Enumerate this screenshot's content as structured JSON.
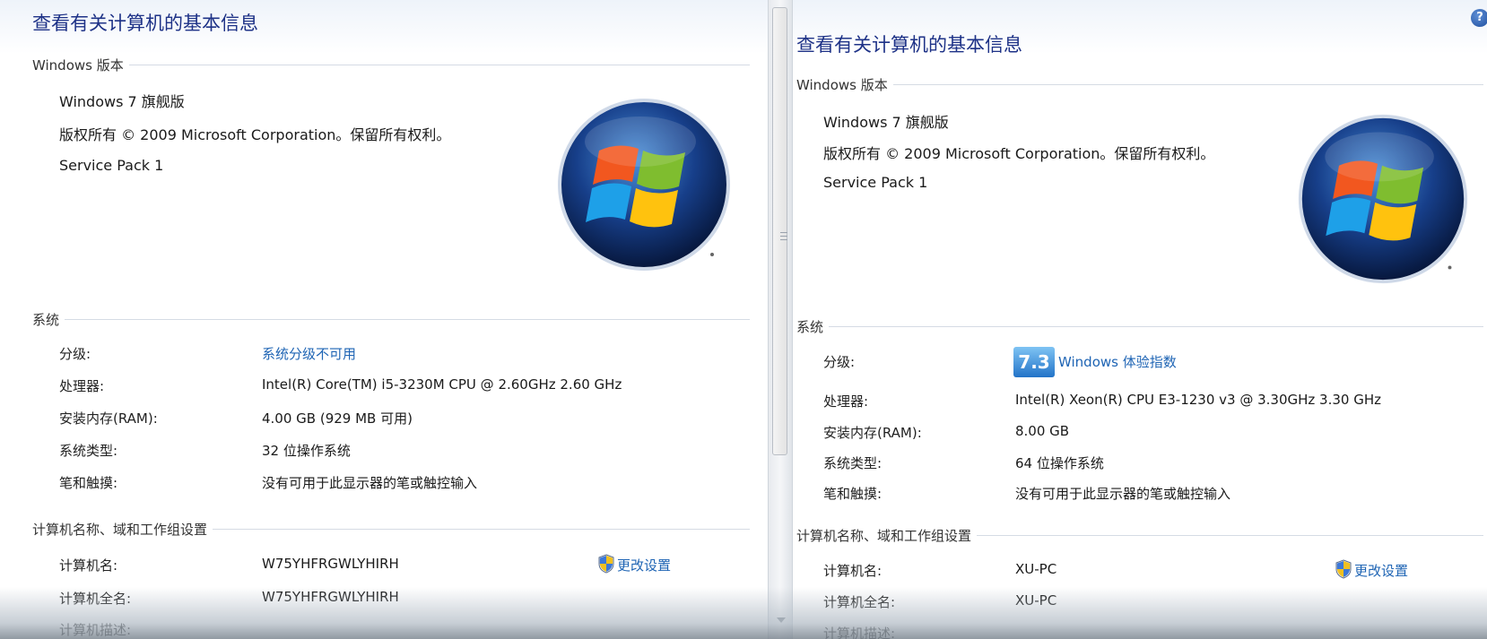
{
  "left": {
    "title": "查看有关计算机的基本信息",
    "edition_header": "Windows 版本",
    "edition": "Windows 7 旗舰版",
    "copyright": "版权所有 © 2009 Microsoft Corporation。保留所有权利。",
    "service_pack": "Service Pack 1",
    "system_header": "系统",
    "labels": {
      "rating": "分级:",
      "processor": "处理器:",
      "ram": "安装内存(RAM):",
      "system_type": "系统类型:",
      "pen_touch": "笔和触摸:"
    },
    "values": {
      "rating_link": "系统分级不可用",
      "processor": "Intel(R) Core(TM) i5-3230M CPU @ 2.60GHz   2.60 GHz",
      "ram": "4.00 GB (929 MB 可用)",
      "system_type": "32 位操作系统",
      "pen_touch": "没有可用于此显示器的笔或触控输入"
    },
    "computer_header": "计算机名称、域和工作组设置",
    "computer": {
      "name_label": "计算机名:",
      "name_value": "W75YHFRGWLYHIRH",
      "fullname_label": "计算机全名:",
      "fullname_value": "W75YHFRGWLYHIRH",
      "desc_label": "计算机描述:",
      "change_settings": "更改设置"
    }
  },
  "right": {
    "title": "查看有关计算机的基本信息",
    "edition_header": "Windows 版本",
    "edition": "Windows 7 旗舰版",
    "copyright": "版权所有 © 2009 Microsoft Corporation。保留所有权利。",
    "service_pack": "Service Pack 1",
    "system_header": "系统",
    "labels": {
      "rating": "分级:",
      "processor": "处理器:",
      "ram": "安装内存(RAM):",
      "system_type": "系统类型:",
      "pen_touch": "笔和触摸:"
    },
    "values": {
      "wei_score": "7.3",
      "wei_link": "Windows 体验指数",
      "processor": "Intel(R) Xeon(R) CPU E3-1230 v3 @ 3.30GHz   3.30 GHz",
      "ram": "8.00 GB",
      "system_type": "64 位操作系统",
      "pen_touch": "没有可用于此显示器的笔或触控输入"
    },
    "computer_header": "计算机名称、域和工作组设置",
    "computer": {
      "name_label": "计算机名:",
      "name_value": "XU-PC",
      "fullname_label": "计算机全名:",
      "fullname_value": "XU-PC",
      "desc_label": "计算机描述:",
      "change_settings": "更改设置"
    }
  },
  "help_glyph": "?",
  "icons": {
    "logo": "windows-logo-icon",
    "shield": "uac-shield-icon",
    "help": "help-icon"
  },
  "colors": {
    "title": "#1e3287",
    "link": "#1e64b4"
  }
}
